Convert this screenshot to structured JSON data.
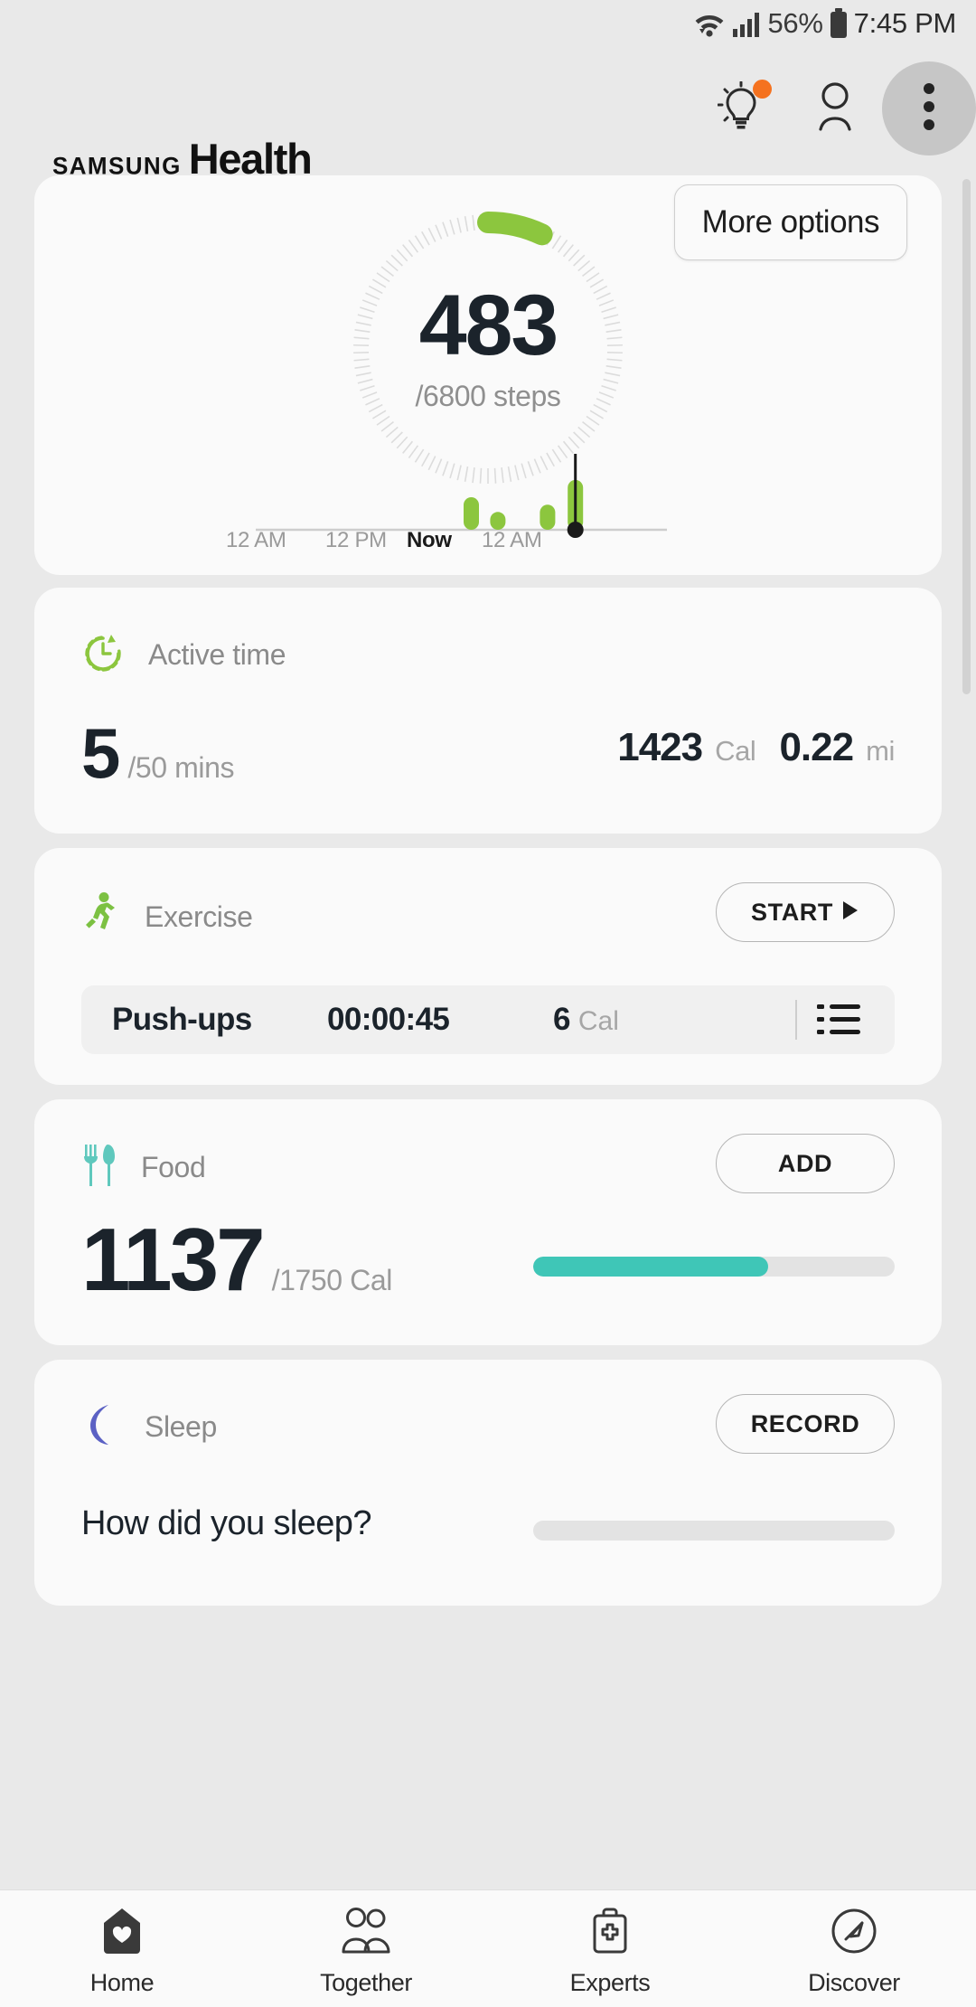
{
  "statusbar": {
    "wifi_icon": "wifi-icon",
    "signal_icon": "cellular-signal-icon",
    "battery_percent": "56%",
    "battery_icon": "battery-icon",
    "time": "7:45 PM"
  },
  "appbar": {
    "brand_samsung": "SAMSUNG",
    "brand_health": "Health",
    "tips_icon": "lightbulb-icon",
    "tips_badge": "notification-dot",
    "profile_icon": "profile-icon",
    "overflow_icon": "more-vertical-icon"
  },
  "steps_card": {
    "value": "483",
    "goal": "/6800 steps",
    "tooltip": "More options",
    "ring_color": "#8cc63e",
    "ring_track_color": "#e2e2e2",
    "progress_percent": 7,
    "timeline": {
      "labels": [
        "12 AM",
        "12 PM",
        "Now",
        "12 AM"
      ],
      "now_label": "Now"
    }
  },
  "active_card": {
    "icon": "active-time-clock-icon",
    "label": "Active time",
    "value": "5",
    "unit": "/50 mins",
    "calories_value": "1423",
    "calories_unit": "Cal",
    "distance_value": "0.22",
    "distance_unit": "mi",
    "accent": "#8cc63e"
  },
  "exercise_card": {
    "icon": "running-person-icon",
    "label": "Exercise",
    "button": "START",
    "button_icon": "play-icon",
    "entry": {
      "name": "Push-ups",
      "duration": "00:00:45",
      "calories_value": "6",
      "calories_unit": "Cal",
      "list_icon": "list-icon"
    },
    "accent": "#8cc63e"
  },
  "food_card": {
    "icon": "fork-knife-icon",
    "label": "Food",
    "value": "1137",
    "goal": "/1750 Cal",
    "button": "ADD",
    "progress_percent": 65,
    "accent": "#3fc6b7"
  },
  "sleep_card": {
    "icon": "moon-icon",
    "label": "Sleep",
    "button": "RECORD",
    "question": "How did you sleep?",
    "progress_percent": 0,
    "accent": "#5b61c4"
  },
  "bottomnav": {
    "items": [
      {
        "label": "Home",
        "icon": "home-icon",
        "active": true
      },
      {
        "label": "Together",
        "icon": "people-icon",
        "active": false
      },
      {
        "label": "Experts",
        "icon": "medkit-icon",
        "active": false
      },
      {
        "label": "Discover",
        "icon": "compass-icon",
        "active": false
      }
    ]
  },
  "chart_data": {
    "type": "bar",
    "title": "Step activity timeline",
    "xlabel": "",
    "ylabel": "steps",
    "categories": [
      "12 AM",
      "12 PM",
      "Now",
      "12 AM"
    ],
    "x_tick_positions": [
      0.18,
      0.52,
      0.66,
      0.8
    ],
    "bars": [
      {
        "x_frac": 0.505,
        "height_frac": 0.62
      },
      {
        "x_frac": 0.545,
        "height_frac": 0.34
      },
      {
        "x_frac": 0.62,
        "height_frac": 0.48
      },
      {
        "x_frac": 0.662,
        "height_frac": 0.95
      }
    ],
    "bar_color": "#8cc63e",
    "axis_color": "#cdcdcd",
    "now_marker": {
      "x_frac": 0.662,
      "color": "#1a1a1a"
    },
    "grid": false,
    "legend": false
  }
}
